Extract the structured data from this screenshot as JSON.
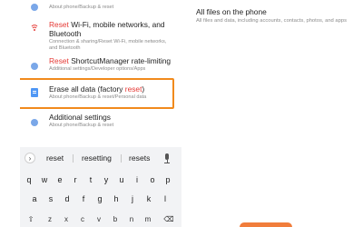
{
  "left_screen": {
    "results": [
      {
        "title_plain": "",
        "title_hl": "",
        "title_after": "",
        "subtitle": "About phone/Backup & reset",
        "icon": "backup-icon"
      },
      {
        "title_hl": "Reset",
        "title_after": " Wi-Fi, mobile networks, and Bluetooth",
        "subtitle": "Connection & sharing/Reset Wi-Fi, mobile networks, and Bluetooth",
        "icon": "reset-network-icon"
      },
      {
        "title_hl": "Reset",
        "title_after": " ShortcutManager rate-limiting",
        "subtitle": "Additional settings/Developer options/Apps",
        "icon": "dot-icon"
      },
      {
        "title_before": "Erase all data (factory ",
        "title_hl": "reset",
        "title_after": ")",
        "subtitle": "About phone/Backup & reset/Personal data",
        "icon": "erase-data-icon"
      },
      {
        "title_plain": "Additional settings",
        "subtitle": "About phone/Backup & reset",
        "icon": "dot-icon"
      }
    ],
    "keyboard": {
      "suggestions": [
        "reset",
        "resetting",
        "resets"
      ],
      "row1": [
        "q",
        "w",
        "e",
        "r",
        "t",
        "y",
        "u",
        "i",
        "o",
        "p"
      ],
      "row2": [
        "a",
        "s",
        "d",
        "f",
        "g",
        "h",
        "j",
        "k",
        "l"
      ],
      "row3": [
        "z",
        "x",
        "c",
        "v",
        "b",
        "n",
        "m"
      ]
    }
  },
  "right_screen": {
    "title": "All files on the phone",
    "description": "All files and data, including accounts, contacts, photos, and apps",
    "accent_color": "#f17d3b"
  },
  "colors": {
    "highlight_text": "#e53935",
    "highlight_border": "#f18a1c",
    "icon_blue": "#4f97f5"
  }
}
